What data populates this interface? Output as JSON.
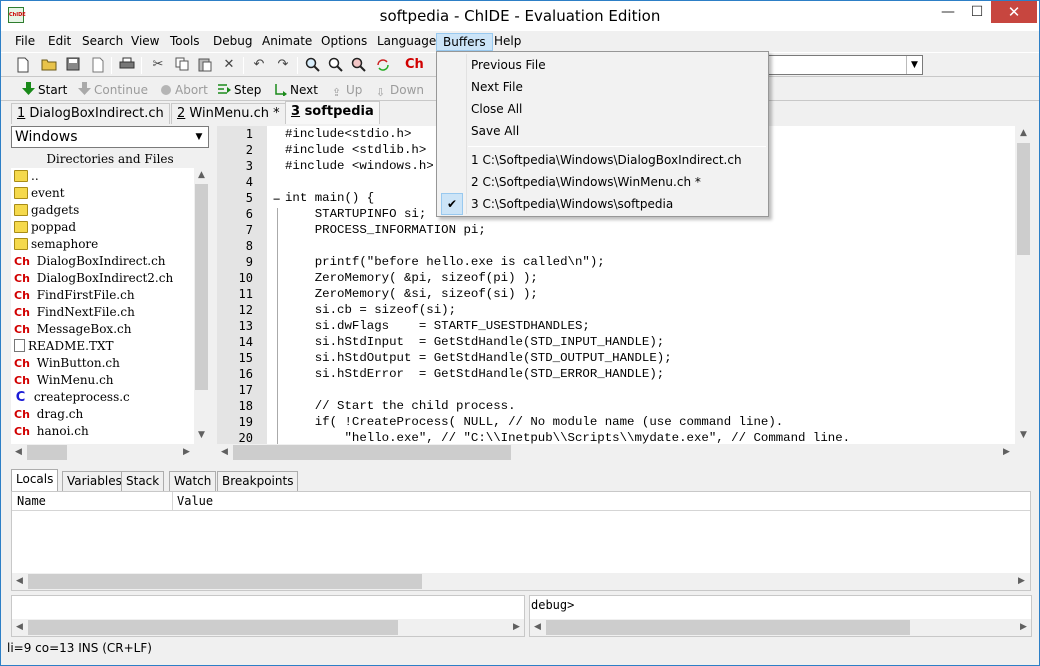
{
  "window": {
    "title": "softpedia - ChIDE - Evaluation Edition",
    "app_icon_text": "ChIDE",
    "controls": {
      "minimize": "—",
      "maximize": "☐",
      "close": "✕"
    }
  },
  "menubar": [
    "File",
    "Edit",
    "Search",
    "View",
    "Tools",
    "Debug",
    "Animate",
    "Options",
    "Language",
    "Buffers",
    "Help"
  ],
  "toolbar_icons": [
    "new-file-icon",
    "open-folder-icon",
    "save-icon",
    "save-all-icon",
    "print-icon",
    "cut-icon",
    "copy-icon",
    "paste-icon",
    "delete-icon",
    "undo-icon",
    "redo-icon",
    "find-icon",
    "find-next-icon",
    "find-prev-icon",
    "replace-icon",
    "ch-compile-icon"
  ],
  "debug_toolbar": {
    "start": "Start",
    "continue": "Continue",
    "abort": "Abort",
    "step": "Step",
    "next": "Next",
    "up": "Up",
    "down": "Down"
  },
  "file_tabs": [
    {
      "num": "1",
      "name": " DialogBoxIndirect.ch"
    },
    {
      "num": "2",
      "name": " WinMenu.ch *"
    },
    {
      "num": "3",
      "name": " softpedia"
    }
  ],
  "left_panel": {
    "combo_value": "Windows",
    "header": "Directories and Files",
    "items": [
      {
        "type": "folder",
        "name": ".."
      },
      {
        "type": "folder",
        "name": "event"
      },
      {
        "type": "folder",
        "name": "gadgets"
      },
      {
        "type": "folder",
        "name": "poppad"
      },
      {
        "type": "folder",
        "name": "semaphore"
      },
      {
        "type": "ch",
        "name": "DialogBoxIndirect.ch"
      },
      {
        "type": "ch",
        "name": "DialogBoxIndirect2.ch"
      },
      {
        "type": "ch",
        "name": "FindFirstFile.ch"
      },
      {
        "type": "ch",
        "name": "FindNextFile.ch"
      },
      {
        "type": "ch",
        "name": "MessageBox.ch"
      },
      {
        "type": "txt",
        "name": "README.TXT"
      },
      {
        "type": "ch",
        "name": "WinButton.ch"
      },
      {
        "type": "ch",
        "name": "WinMenu.ch"
      },
      {
        "type": "c",
        "name": "createprocess.c"
      },
      {
        "type": "ch",
        "name": "drag.ch"
      },
      {
        "type": "ch",
        "name": "hanoi.ch"
      }
    ],
    "ch_icon_text": "Ch",
    "c_icon_text": "C"
  },
  "editor": {
    "line_numbers": [
      "1",
      "2",
      "3",
      "4",
      "5",
      "6",
      "7",
      "8",
      "9",
      "10",
      "11",
      "12",
      "13",
      "14",
      "15",
      "16",
      "17",
      "18",
      "19",
      "20"
    ],
    "fold_marker": "−",
    "lines": [
      "#include<stdio.h>",
      "#include <stdlib.h>",
      "#include <windows.h>",
      "",
      "int main() {",
      "    STARTUPINFO si;",
      "    PROCESS_INFORMATION pi;",
      "",
      "    printf(\"before hello.exe is called\\n\");",
      "    ZeroMemory( &pi, sizeof(pi) );",
      "    ZeroMemory( &si, sizeof(si) );",
      "    si.cb = sizeof(si);",
      "    si.dwFlags    = STARTF_USESTDHANDLES;",
      "    si.hStdInput  = GetStdHandle(STD_INPUT_HANDLE);",
      "    si.hStdOutput = GetStdHandle(STD_OUTPUT_HANDLE);",
      "    si.hStdError  = GetStdHandle(STD_ERROR_HANDLE);",
      "",
      "    // Start the child process.",
      "    if( !CreateProcess( NULL, // No module name (use command line).",
      "        \"hello.exe\", // \"C:\\\\Inetpub\\\\Scripts\\\\mydate.exe\", // Command line."
    ]
  },
  "debug_tabs": [
    "Locals",
    "Variables",
    "Stack",
    "Watch",
    "Breakpoints"
  ],
  "vars_columns": [
    "Name",
    "Value"
  ],
  "console_prompt": "debug>",
  "status_text": "li=9 co=13 INS (CR+LF)",
  "buffers_menu": {
    "items": [
      "Previous File",
      "Next File",
      "Close All",
      "Save All"
    ],
    "recent": [
      "1 C:\\Softpedia\\Windows\\DialogBoxIndirect.ch",
      "2 C:\\Softpedia\\Windows\\WinMenu.ch *",
      "3 C:\\Softpedia\\Windows\\softpedia"
    ],
    "checked_index": 2,
    "check_glyph": "✔"
  },
  "colors": {
    "menu_highlight": "#cce4f7",
    "close_button": "#c7463f",
    "ch_icon": "#d10000",
    "c_icon": "#1a1ad6",
    "folder": "#f5d94c"
  }
}
